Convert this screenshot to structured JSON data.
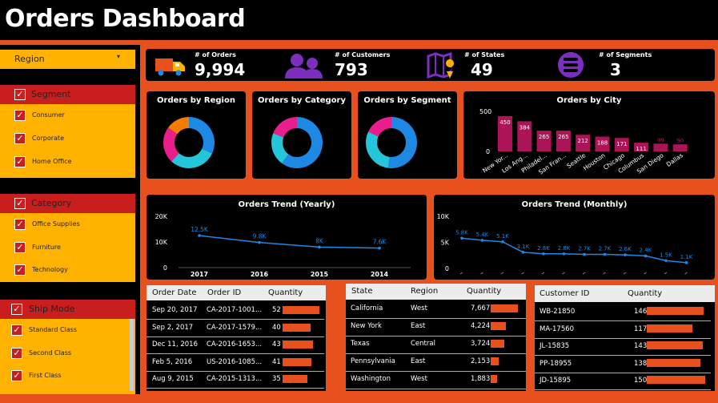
{
  "title": "Orders Dashboard",
  "filters": {
    "region_label": "Region",
    "segment": {
      "label": "Segment",
      "items": [
        "Consumer",
        "Corporate",
        "Home Office"
      ]
    },
    "category": {
      "label": "Category",
      "items": [
        "Office Supplies",
        "Furniture",
        "Technology"
      ]
    },
    "ship_mode": {
      "label": "Ship Mode",
      "items": [
        "Standard Class",
        "Second Class",
        "First Class"
      ]
    }
  },
  "kpis": [
    {
      "label": "# of Orders",
      "value": "9,994",
      "icon": "truck-icon"
    },
    {
      "label": "# of Customers",
      "value": "793",
      "icon": "users-icon"
    },
    {
      "label": "# of States",
      "value": "49",
      "icon": "map-pin-icon"
    },
    {
      "label": "# of Segments",
      "value": "3",
      "icon": "database-icon"
    }
  ],
  "donuts": {
    "region": {
      "title": "Orders by Region",
      "slices": [
        0.32,
        0.3,
        0.23,
        0.15
      ],
      "colors": [
        "#1e88e5",
        "#26c6da",
        "#e91e8c",
        "#f57c00"
      ]
    },
    "category": {
      "title": "Orders by Category",
      "slices": [
        0.6,
        0.21,
        0.19
      ],
      "colors": [
        "#1e88e5",
        "#26c6da",
        "#e91e8c"
      ]
    },
    "segment": {
      "title": "Orders by Segment",
      "slices": [
        0.52,
        0.3,
        0.18
      ],
      "colors": [
        "#1e88e5",
        "#26c6da",
        "#e91e8c"
      ]
    }
  },
  "chart_data": [
    {
      "type": "bar",
      "title": "Orders by City",
      "categories": [
        "New York City",
        "Los Angeles",
        "Philadelphia",
        "San Francisco",
        "Seattle",
        "Houston",
        "Chicago",
        "Columbus",
        "San Diego",
        "Dallas"
      ],
      "tick_labels": [
        "New Yor...",
        "Los Ang...",
        "Philadel...",
        "San Fran...",
        "Seattle",
        "Houston",
        "Chicago",
        "Columbus",
        "San Diego",
        "Dallas"
      ],
      "values": [
        450,
        384,
        265,
        265,
        212,
        188,
        171,
        111,
        99,
        90
      ],
      "value_labels": [
        "450",
        "384",
        "265",
        "265",
        "212",
        "188",
        "171",
        "111",
        "99",
        "90"
      ],
      "yticks": [
        "500",
        "0"
      ],
      "ylim": [
        0,
        500
      ],
      "color": "#ad1457"
    },
    {
      "type": "line",
      "title": "Orders Trend (Yearly)",
      "categories": [
        "2017",
        "2016",
        "2015",
        "2014"
      ],
      "values": [
        12500,
        9800,
        8000,
        7600
      ],
      "value_labels": [
        "12.5K",
        "9.8K",
        "8K",
        "7.6K"
      ],
      "yticks": [
        "20K",
        "10K",
        "0"
      ],
      "ylim": [
        0,
        20000
      ],
      "color": "#1e88e5"
    },
    {
      "type": "line",
      "title": "Orders Trend (Monthly)",
      "values": [
        5800,
        5400,
        5100,
        3100,
        2800,
        2800,
        2700,
        2700,
        2600,
        2400,
        1500,
        1100
      ],
      "value_labels": [
        "5.8K",
        "5.4K",
        "5.1K",
        "3.1K",
        "2.8K",
        "2.8K",
        "2.7K",
        "2.7K",
        "2.6K",
        "2.4K",
        "1.5K",
        "1.1K"
      ],
      "yticks": [
        "10K",
        "5K",
        "0"
      ],
      "ylim": [
        0,
        10000
      ],
      "color": "#1e88e5"
    }
  ],
  "orders_table": {
    "headers": [
      "Order Date",
      "Order ID",
      "Quantity"
    ],
    "rows": [
      {
        "date": "Sep 20, 2017",
        "id": "CA-2017-1001...",
        "qty": "52",
        "q": 52
      },
      {
        "date": "Sep 2, 2017",
        "id": "CA-2017-1579...",
        "qty": "40",
        "q": 40
      },
      {
        "date": "Dec 11, 2016",
        "id": "CA-2016-1653...",
        "qty": "43",
        "q": 43
      },
      {
        "date": "Feb 5, 2016",
        "id": "US-2016-1085...",
        "qty": "41",
        "q": 41
      },
      {
        "date": "Aug 9, 2015",
        "id": "CA-2015-1313...",
        "qty": "35",
        "q": 35
      }
    ]
  },
  "states_table": {
    "headers": [
      "State",
      "Region",
      "Quantity"
    ],
    "rows": [
      {
        "state": "California",
        "region": "West",
        "qty": "7,667",
        "q": 7667
      },
      {
        "state": "New York",
        "region": "East",
        "qty": "4,224",
        "q": 4224
      },
      {
        "state": "Texas",
        "region": "Central",
        "qty": "3,724",
        "q": 3724
      },
      {
        "state": "Pennsylvania",
        "region": "East",
        "qty": "2,153",
        "q": 2153
      },
      {
        "state": "Washington",
        "region": "West",
        "qty": "1,883",
        "q": 1883
      }
    ]
  },
  "customers_table": {
    "headers": [
      "Customer ID",
      "Quantity"
    ],
    "rows": [
      {
        "id": "WB-21850",
        "qty": "146",
        "q": 146
      },
      {
        "id": "MA-17560",
        "qty": "117",
        "q": 117
      },
      {
        "id": "JL-15835",
        "qty": "143",
        "q": 143
      },
      {
        "id": "PP-18955",
        "qty": "138",
        "q": 138
      },
      {
        "id": "JD-15895",
        "qty": "150",
        "q": 150
      }
    ]
  }
}
